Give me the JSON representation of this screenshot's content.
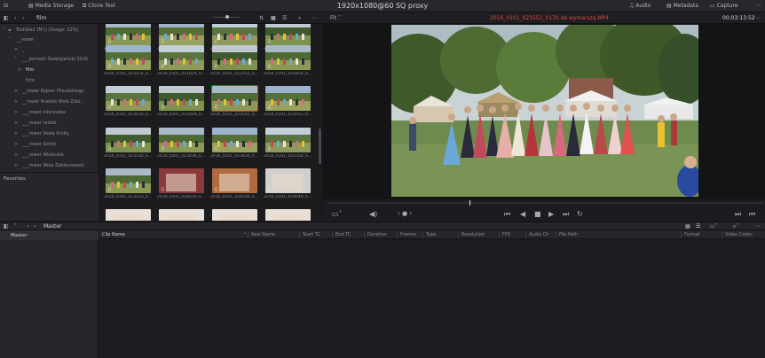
{
  "topbar": {
    "media_storage": "Media Storage",
    "clone_tool": "Clone Tool",
    "title": "1920x1080@60 SQ proxy",
    "audio": "Audio",
    "metadata": "Metadata",
    "capture": "Capture"
  },
  "bar2": {
    "bin": "film",
    "fit": "Fit",
    "clip_name": "2016_0101_023552_017b de wymarszą.MP4",
    "timecode": "00:03:13:52"
  },
  "tree": {
    "items": [
      {
        "label": "Toshiba1 (M:\\) (Usage: 32%)",
        "chev": "˅",
        "level": 0
      },
      {
        "label": "__rower",
        "chev": "˅",
        "level": 1
      },
      {
        "label": "_",
        "chev": ">",
        "level": 2
      },
      {
        "label": "___Jarmark Świętojański 2016",
        "chev": "˅",
        "level": 2
      },
      {
        "label": "film",
        "chev": ">",
        "level": 3,
        "selected": true
      },
      {
        "label": "foto",
        "chev": "",
        "level": 3
      },
      {
        "label": "__rower Kopiec Piłsudskiego",
        "chev": ">",
        "level": 2
      },
      {
        "label": "__rower Kraków Wola Zobi...",
        "chev": ">",
        "level": 2
      },
      {
        "label": "___rower młynowka",
        "chev": ">",
        "level": 2
      },
      {
        "label": "___rower rodzie",
        "chev": ">",
        "level": 2
      },
      {
        "label": "___rower Skała Kmity",
        "chev": ">",
        "level": 2
      },
      {
        "label": "___rower Solnik",
        "chev": ">",
        "level": 2
      },
      {
        "label": "___rower Wieliczka",
        "chev": ">",
        "level": 2
      },
      {
        "label": "___rower Wola Zabierzowski",
        "chev": ">",
        "level": 2
      }
    ],
    "favorites": "Favorites"
  },
  "pool": {
    "rows": [
      [
        "2016_0101_022800_0...",
        "2016_0101_022830_0...",
        "2016_0101_022111_0...",
        "2016_0101_022140_0..."
      ],
      [
        "2016_0101_023154_0...",
        "2016_0101_021629_0...",
        "2016_0101_022012_0...",
        "2016_0101_022859_0..."
      ],
      [
        "2016_0101_023534_0...",
        "2016_0101_021809_0...",
        "2016_0101_023552_0...",
        "2016_0101_023552_0..."
      ],
      [
        "2016_0101_023530_0...",
        "2016_0101_023438_0...",
        "2016_0101_023434_0...",
        "2016_0101_023354_0..."
      ],
      [
        "2016_0101_023213_0...",
        "2016_0101_028239_0...",
        "2016_0101_028206_0...",
        "2016_0101_024049_0..."
      ],
      [
        "",
        "",
        "",
        ""
      ]
    ]
  },
  "lower": {
    "bin_title": "Master",
    "master_item": "Master",
    "columns": [
      "Clip Name",
      "Reel Name",
      "Start TC",
      "End TC",
      "Duration",
      "Frames",
      "Type",
      "Resolution",
      "FPS",
      "Audio Ch",
      "File Path",
      "Format",
      "Video Codec"
    ]
  },
  "colors": {
    "accent_red": "#e0463a",
    "selection_red": "#c0392b"
  }
}
